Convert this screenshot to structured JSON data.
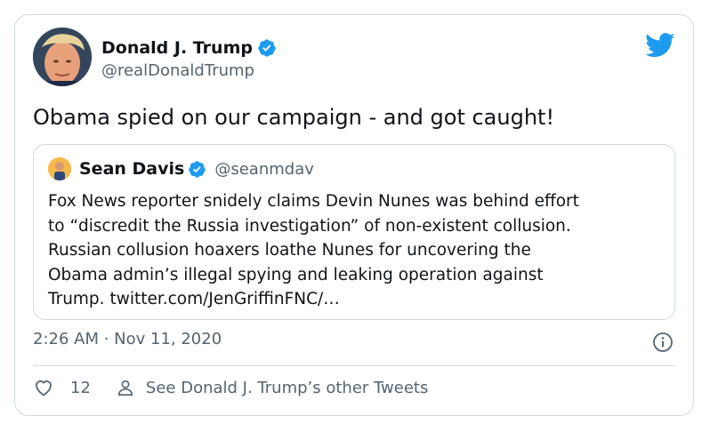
{
  "author": {
    "name": "Donald J. Trump",
    "handle": "@realDonaldTrump"
  },
  "tweet": {
    "text": "Obama spied on our campaign - and got caught!"
  },
  "quoted": {
    "name": "Sean Davis",
    "handle": "@seanmdav",
    "lines": [
      "Fox News reporter snidely claims Devin Nunes was behind effort",
      "to “discredit the Russia investigation” of non-existent collusion.",
      "Russian collusion hoaxers loathe Nunes for uncovering the",
      "Obama admin’s illegal spying and leaking operation against",
      "Trump. twitter.com/JenGriffinFNC/…"
    ]
  },
  "meta": {
    "timestamp": "2:26 AM · Nov 11, 2020"
  },
  "actions": {
    "likes": "12",
    "other_tweets": "See Donald J. Trump’s other Tweets"
  },
  "colors": {
    "brand": "#1d9bf0",
    "secondary_text": "#536471",
    "border": "#cfd9de"
  },
  "icons": {
    "logo": "twitter-bird-icon",
    "verified": "verified-badge-icon",
    "info": "info-icon",
    "like": "heart-icon",
    "profile": "person-icon"
  }
}
